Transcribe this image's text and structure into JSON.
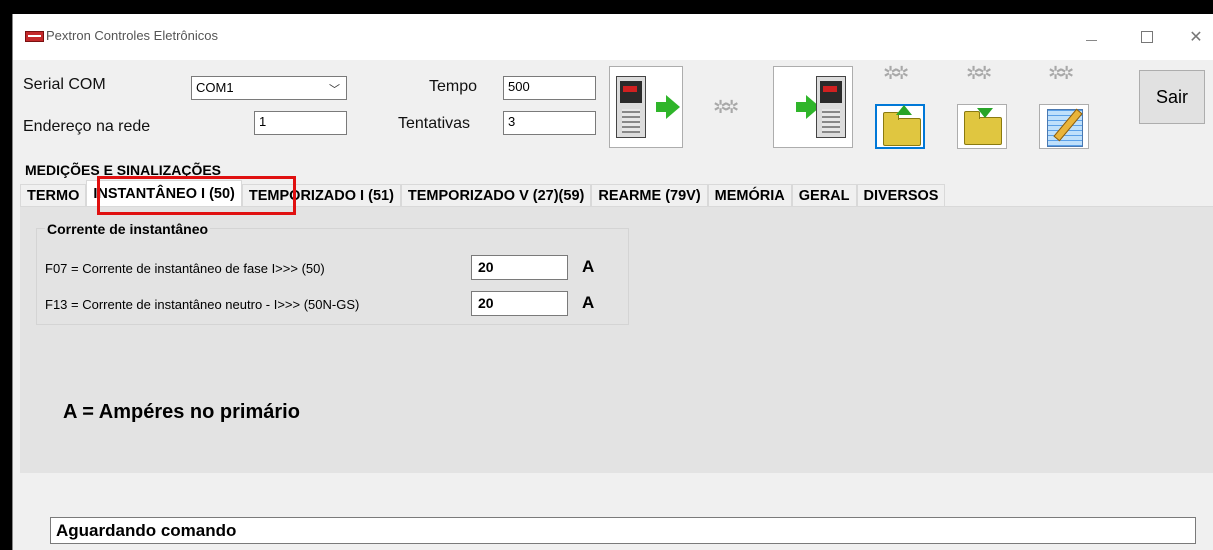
{
  "window": {
    "title": "Pextron Controles Eletrônicos",
    "minimize": "—",
    "maximize": "☐",
    "close": "✕"
  },
  "config": {
    "serial_label": "Serial COM",
    "serial_value": "COM1",
    "address_label": "Endereço na rede",
    "address_value": "1",
    "tempo_label": "Tempo",
    "tempo_value": "500",
    "tentativas_label": "Tentativas",
    "tentativas_value": "3"
  },
  "toolbar": {
    "exit_label": "Sair",
    "icons": [
      "device-send-icon",
      "gears-icon",
      "device-receive-icon",
      "gears-icon",
      "folder-open-icon",
      "gears-icon",
      "folder-save-icon",
      "gears-icon",
      "notepad-edit-icon"
    ]
  },
  "tabs": {
    "top_row": "MEDIÇÕES E SINALIZAÇÕES",
    "items": [
      "TERMO",
      "INSTANTÂNEO I (50)",
      "TEMPORIZADO I (51)",
      "TEMPORIZADO V (27)(59)",
      "REARME (79V)",
      "MEMÓRIA",
      "GERAL",
      "DIVERSOS"
    ],
    "active": "INSTANTÂNEO I (50)"
  },
  "group": {
    "title": "Corrente de instantâneo",
    "rows": [
      {
        "label": "F07 = Corrente de instantâneo de fase I>>> (50)",
        "value": "20",
        "unit": "A"
      },
      {
        "label": "F13 = Corrente de instantâneo neutro - I>>> (50N-GS)",
        "value": "20",
        "unit": "A"
      }
    ]
  },
  "legend": "A = Ampéres no primário",
  "status": "Aguardando comando",
  "colors": {
    "highlight": "#e01010",
    "accent_blue": "#0078d7"
  }
}
